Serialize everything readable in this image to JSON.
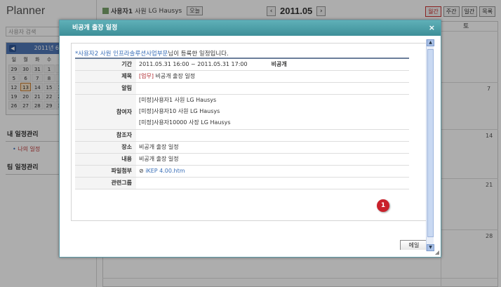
{
  "app": {
    "title": "Planner"
  },
  "sidebar": {
    "search_placeholder": "사용자 검색",
    "mini_calendar": {
      "header": "2011년 6월",
      "weekdays": [
        "일",
        "월",
        "화",
        "수",
        "목",
        "금",
        "토"
      ],
      "rows": [
        [
          "29",
          "30",
          "31",
          "1",
          "2",
          "3",
          "4"
        ],
        [
          "5",
          "6",
          "7",
          "8",
          "9",
          "10",
          "11"
        ],
        [
          "12",
          "13",
          "14",
          "15",
          "16",
          "17",
          "18"
        ],
        [
          "19",
          "20",
          "21",
          "22",
          "23",
          "24",
          "25"
        ],
        [
          "26",
          "27",
          "28",
          "29",
          "30",
          "1",
          "2"
        ]
      ],
      "today": "13"
    },
    "my_schedule_title": "내 일정관리",
    "my_schedule_link": "나의 일정",
    "team_schedule_title": "팀 일정관리"
  },
  "header": {
    "user_label": "사용자1",
    "user_rank": "사원",
    "user_company": "LG Hausys",
    "today_button": "오늘",
    "date_label": "2011.05",
    "prev_icon": "chevron-left-icon",
    "next_icon": "chevron-right-icon",
    "view_buttons": [
      "월간",
      "주간",
      "일간",
      "목록"
    ],
    "active_view": "월간"
  },
  "calendar_bg": {
    "sat_header": "토",
    "week_dates": [
      "7",
      "14",
      "21",
      "28"
    ]
  },
  "modal": {
    "title": "비공개 출장 일정",
    "close_icon": "close-icon",
    "notice_who": "*사용자2 사원 인프라솔루션사업부문",
    "notice_text": "님이 등록한 일정입니다.",
    "rows": {
      "period_label": "기간",
      "period_value": "2011.05.31  16:00 ~ 2011.05.31  17:00",
      "visibility": "비공개",
      "subject_label": "제목",
      "subject_tag": "[업무]",
      "subject_value": "비공개 출장 일정",
      "alarm_label": "알림",
      "participants_label": "참여자",
      "participants": [
        "[미정]사용자1 사원 LG Hausys",
        "[미정]사용자10 사원 LG Hausys",
        "[미정]사용자10000 사장 LG Hausys"
      ],
      "cc_label": "참조자",
      "place_label": "장소",
      "place_value": "비공개 출장 일정",
      "content_label": "내용",
      "content_value": "비공개 출장 일정",
      "attachment_label": "파일첨부",
      "attachment_value": "iKEP 4.00.htm",
      "related_group_label": "관련그룹"
    },
    "mail_button": "메일",
    "badge_number": "1"
  }
}
